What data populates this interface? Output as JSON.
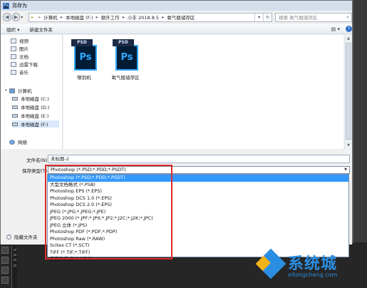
{
  "window": {
    "title": "另存为"
  },
  "nav": {
    "breadcrumb": [
      "计算机",
      "本地磁盘 (F:)",
      "额外工作",
      "小丰 2018.8.5",
      "氧气瓶储存区"
    ],
    "search_placeholder": "搜索 氧气瓶储存区"
  },
  "toolbar": {
    "organize": "组织 ▾",
    "new_folder": "新建文件夹"
  },
  "sidebar": {
    "items": [
      "视频",
      "图片",
      "文档",
      "迅雷下载",
      "音乐",
      "计算机",
      "本地磁盘 (C:)",
      "本地磁盘 (D:)",
      "本地磁盘 (E:)",
      "本地磁盘 (F:)",
      "网络"
    ]
  },
  "files": [
    {
      "name": "哪到机",
      "badge": "PSD",
      "logo": "Ps"
    },
    {
      "name": "氧气瓶储存区",
      "badge": "PSD",
      "logo": "Ps"
    }
  ],
  "form": {
    "filename_label": "文件名(N):",
    "filename_value": "未标题-2",
    "filetype_label": "保存类型(T):",
    "filetype_value": "Photoshop (*.PSD;*.PDD;*.PSDT)",
    "hide_folders": "隐藏文件夹"
  },
  "filetype_options": [
    "Photoshop (*.PSD;*.PDD;*.PSDT)",
    "大型文档格式 (*.PSB)",
    "Photoshop EPS (*.EPS)",
    "Photoshop DCS 1.0 (*.EPS)",
    "Photoshop DCS 2.0 (*.EPS)",
    "JPEG (*.JPG;*.JPEG;*.JPE)",
    "JPEG 2000 (*.JPF;*.JPX;*.JP2;*.J2C;*.J2K;*.JPC)",
    "JPEG 立体 (*.JPS)",
    "Photoshop PDF (*.PDF;*.PDP)",
    "Photoshop Raw (*.RAW)",
    "Scitex CT (*.SCT)",
    "TIFF (*.TIF;*.TIFF)",
    "多图片格式 (*.MPO)"
  ],
  "ruler": [
    "5",
    "0",
    "5",
    "0"
  ],
  "watermark": {
    "text": "系统城",
    "sub": "xitongcheng.com"
  },
  "colors": {
    "highlight": "#e02a2a",
    "selection": "#3399ff",
    "ps_blue": "#31a8ff",
    "watermark": "#2a8ee3"
  }
}
